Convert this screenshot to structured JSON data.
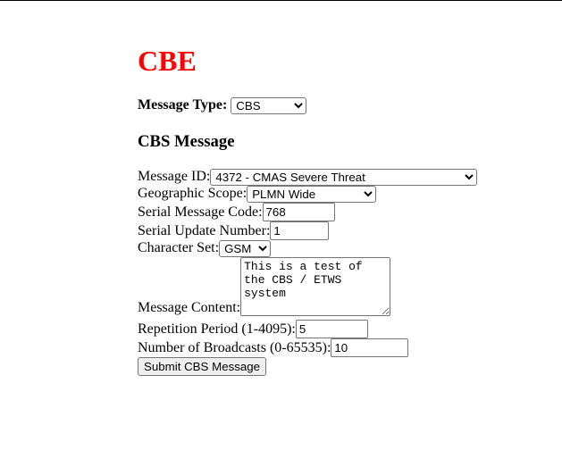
{
  "page": {
    "title": "CBE"
  },
  "message_type": {
    "label": "Message Type:",
    "value": "CBS",
    "options": [
      "CBS"
    ]
  },
  "section_title": "CBS Message",
  "form": {
    "message_id": {
      "label": "Message ID:",
      "value": "4372 - CMAS Severe Threat"
    },
    "geographic_scope": {
      "label": "Geographic Scope:",
      "value": "PLMN Wide"
    },
    "serial_message_code": {
      "label": "Serial Message Code:",
      "value": "768"
    },
    "serial_update_number": {
      "label": "Serial Update Number:",
      "value": "1"
    },
    "character_set": {
      "label": "Character Set:",
      "value": "GSM"
    },
    "message_content": {
      "label": "Message Content:",
      "value": "This is a test of the CBS / ETWS system"
    },
    "repetition_period": {
      "label": "Repetition Period (1-4095):",
      "value": "5"
    },
    "number_of_broadcasts": {
      "label": "Number of Broadcasts (0-65535):",
      "value": "10"
    },
    "submit_label": "Submit CBS Message"
  }
}
